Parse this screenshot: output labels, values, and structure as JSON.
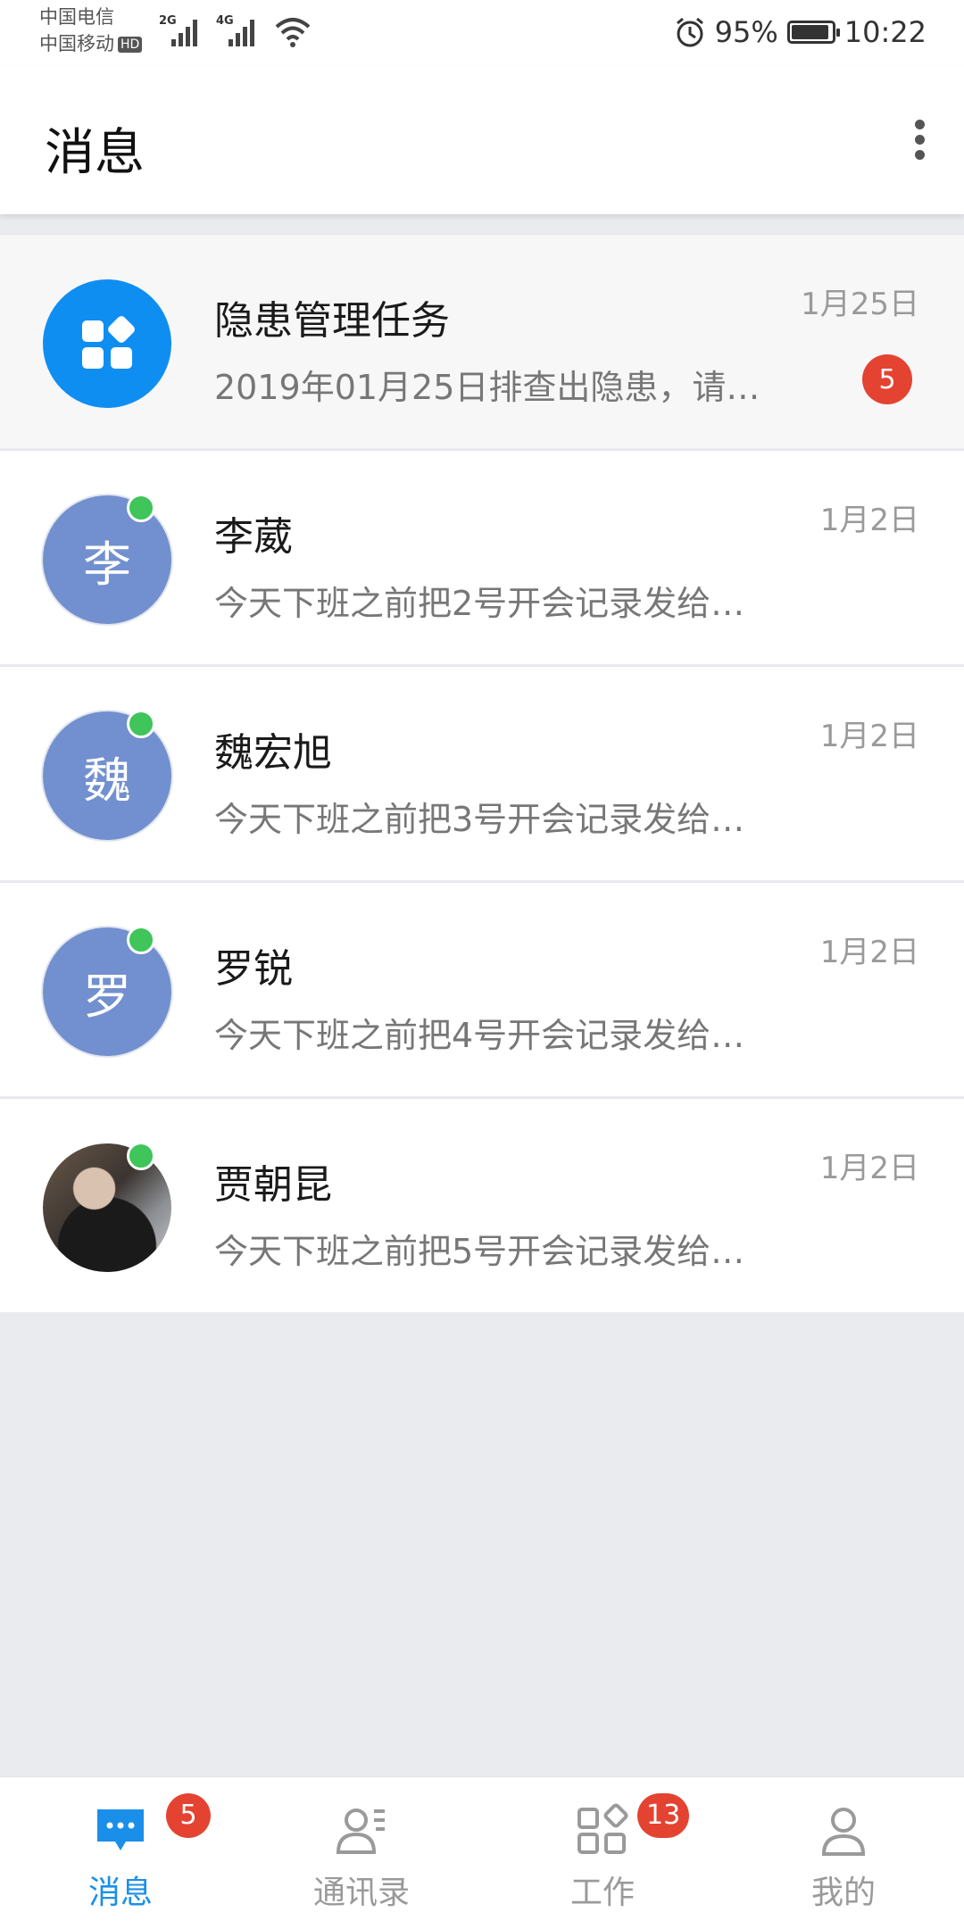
{
  "status_bar": {
    "carrier_1": "中国电信",
    "carrier_2": "中国移动",
    "hd_label": "HD",
    "signal_1": "2G",
    "signal_2": "4G",
    "battery_percent": "95%",
    "battery_level": 0.95,
    "time": "10:22"
  },
  "header": {
    "title": "消息",
    "more_icon": "more-vertical-icon"
  },
  "conversations": [
    {
      "avatar_type": "app",
      "avatar_icon": "grid-apps-icon",
      "avatar_color": "#0f8ef2",
      "name": "隐患管理任务",
      "preview": "2019年01月25日排查出隐患，请…",
      "date": "1月25日",
      "unread": "5",
      "online": false
    },
    {
      "avatar_type": "letter",
      "avatar_text": "李",
      "avatar_color": "#7290cf",
      "name": "李葳",
      "preview": "今天下班之前把2号开会记录发给…",
      "date": "1月2日",
      "online": true
    },
    {
      "avatar_type": "letter",
      "avatar_text": "魏",
      "avatar_color": "#7290cf",
      "name": "魏宏旭",
      "preview": "今天下班之前把3号开会记录发给…",
      "date": "1月2日",
      "online": true
    },
    {
      "avatar_type": "letter",
      "avatar_text": "罗",
      "avatar_color": "#7290cf",
      "name": "罗锐",
      "preview": "今天下班之前把4号开会记录发给…",
      "date": "1月2日",
      "online": true
    },
    {
      "avatar_type": "photo",
      "name": "贾朝昆",
      "preview": "今天下班之前把5号开会记录发给…",
      "date": "1月2日",
      "online": true
    }
  ],
  "tabbar": {
    "tabs": [
      {
        "label": "消息",
        "icon": "chat-bubble-icon",
        "active": true,
        "badge": "5"
      },
      {
        "label": "通讯录",
        "icon": "contacts-icon",
        "active": false,
        "badge": ""
      },
      {
        "label": "工作",
        "icon": "work-grid-icon",
        "active": false,
        "badge": "13"
      },
      {
        "label": "我的",
        "icon": "person-icon",
        "active": false,
        "badge": ""
      }
    ]
  },
  "colors": {
    "accent": "#1a8fe9",
    "badge": "#e44332",
    "online": "#3fc55a",
    "background": "#e9ebef"
  }
}
